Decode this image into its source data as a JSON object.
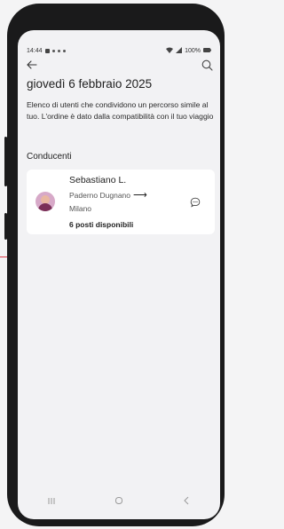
{
  "status_bar": {
    "time": "14:44",
    "battery": "100%"
  },
  "header": {
    "back_icon": "arrow-left-icon",
    "search_icon": "search-icon"
  },
  "page": {
    "title": "giovedì 6 febbraio 2025",
    "description": "Elenco di utenti che condividono un percorso simile al tuo. L'ordine è dato dalla compatibilità con il tuo viaggio",
    "section_title": "Conducenti"
  },
  "drivers": [
    {
      "name": "Sebastiano L.",
      "from": "Paderno Dugnano",
      "to": "Milano",
      "seats": "6 posti disponibili",
      "avatar_icon": "user-avatar",
      "chat_icon": "chat-bubble-icon"
    }
  ],
  "nav": {
    "recent_icon": "recent-apps-icon",
    "home_icon": "home-icon",
    "back_icon": "back-chevron-icon"
  },
  "colors": {
    "accent_line": "#d93b4a",
    "screen_bg": "#f2f2f4",
    "card_bg": "#ffffff",
    "frame": "#1a1a1b"
  }
}
